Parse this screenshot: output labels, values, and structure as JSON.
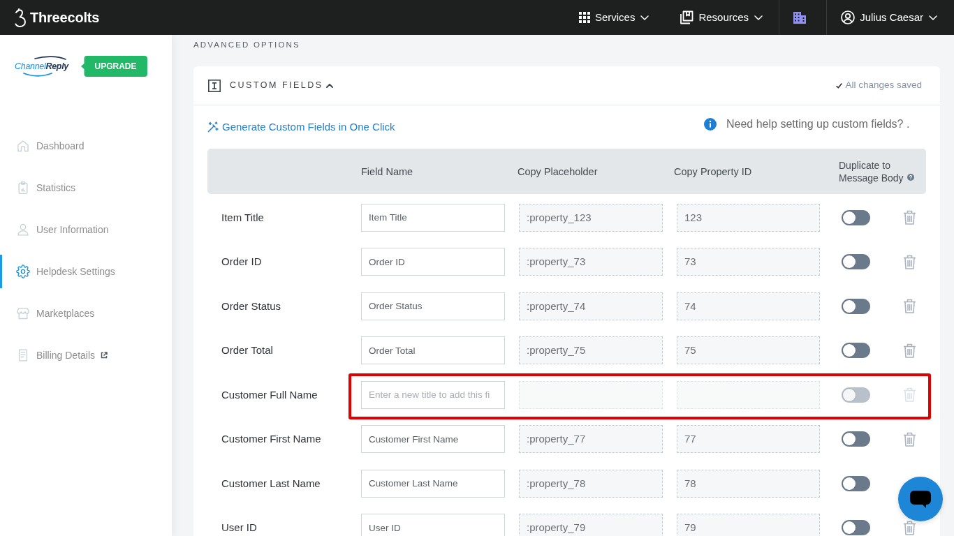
{
  "topbar": {
    "brand": "Threecolts",
    "menus": [
      {
        "label": "Services"
      },
      {
        "label": "Resources"
      }
    ],
    "user": "Julius Caesar"
  },
  "sidebar": {
    "logo": [
      "Channel",
      "Reply"
    ],
    "upgrade": "UPGRADE",
    "items": [
      {
        "label": "Dashboard",
        "selected": false,
        "external": false
      },
      {
        "label": "Statistics",
        "selected": false,
        "external": false
      },
      {
        "label": "User Information",
        "selected": false,
        "external": false
      },
      {
        "label": "Helpdesk Settings",
        "selected": true,
        "external": false
      },
      {
        "label": "Marketplaces",
        "selected": false,
        "external": false
      },
      {
        "label": "Billing Details",
        "selected": false,
        "external": true
      }
    ]
  },
  "section_title": "ADVANCED OPTIONS",
  "custom_fields": {
    "title": "CUSTOM FIELDS",
    "expanded": true,
    "save_status": "All changes saved",
    "generate_link": "Generate Custom Fields in One Click",
    "help_text": "Need help setting up custom fields? .",
    "columns": [
      "Field Name",
      "Copy Placeholder",
      "Copy Property ID",
      "Duplicate to Message Body"
    ],
    "rows": [
      {
        "label": "Item Title",
        "field_name": "Item Title",
        "copy_placeholder": ":property_123",
        "property_id": "123",
        "on": false,
        "disabled": false,
        "highlighted": false
      },
      {
        "label": "Order ID",
        "field_name": "Order ID",
        "copy_placeholder": ":property_73",
        "property_id": "73",
        "on": false,
        "disabled": false,
        "highlighted": false
      },
      {
        "label": "Order Status",
        "field_name": "Order Status",
        "copy_placeholder": ":property_74",
        "property_id": "74",
        "on": false,
        "disabled": false,
        "highlighted": false
      },
      {
        "label": "Order Total",
        "field_name": "Order Total",
        "copy_placeholder": ":property_75",
        "property_id": "75",
        "on": false,
        "disabled": false,
        "highlighted": false
      },
      {
        "label": "Customer Full Name",
        "field_placeholder": "Enter a new title to add this fi",
        "on": false,
        "disabled": true,
        "highlighted": true
      },
      {
        "label": "Customer First Name",
        "field_name": "Customer First Name",
        "copy_placeholder": ":property_77",
        "property_id": "77",
        "on": false,
        "disabled": false,
        "highlighted": false
      },
      {
        "label": "Customer Last Name",
        "field_name": "Customer Last Name",
        "copy_placeholder": ":property_78",
        "property_id": "78",
        "on": false,
        "disabled": false,
        "highlighted": false
      },
      {
        "label": "User ID",
        "field_name": "User ID",
        "copy_placeholder": ":property_79",
        "property_id": "79",
        "on": false,
        "disabled": false,
        "highlighted": false
      }
    ]
  }
}
